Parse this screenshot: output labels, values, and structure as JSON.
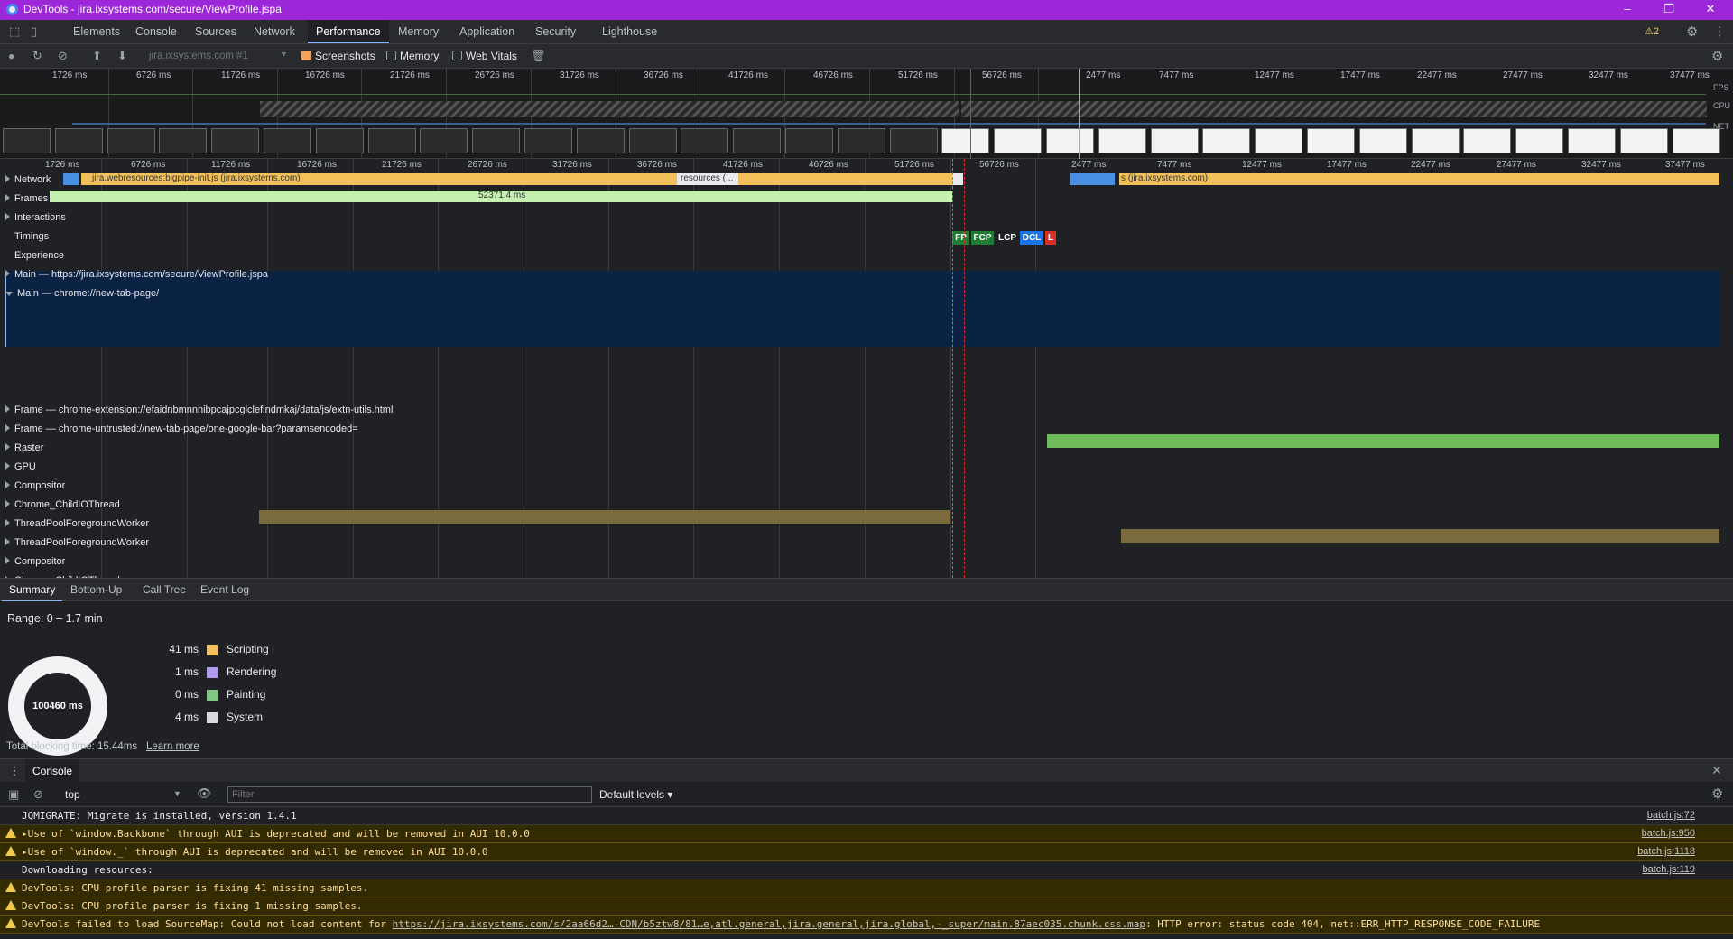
{
  "window": {
    "title": "DevTools - jira.ixsystems.com/secure/ViewProfile.jspa",
    "minimize": "–",
    "restore": "❐",
    "close": "✕"
  },
  "tabs": [
    "Elements",
    "Console",
    "Sources",
    "Network",
    "Performance",
    "Memory",
    "Application",
    "Security",
    "Lighthouse"
  ],
  "active_tab": "Performance",
  "warnings_badge": "⚠2",
  "toolbar": {
    "target_select": "jira.ixsystems.com #1",
    "screenshots_label": "Screenshots",
    "memory_label": "Memory",
    "webvitals_label": "Web Vitals"
  },
  "overview": {
    "ticks_left": [
      "1726 ms",
      "6726 ms",
      "11726 ms",
      "16726 ms",
      "21726 ms",
      "26726 ms",
      "31726 ms",
      "36726 ms",
      "41726 ms",
      "46726 ms",
      "51726 ms",
      "56726 ms"
    ],
    "ticks_right": [
      "2477 ms",
      "7477 ms",
      "12477 ms",
      "17477 ms",
      "22477 ms",
      "27477 ms",
      "32477 ms",
      "37477 ms"
    ],
    "labels": {
      "fps": "FPS",
      "cpu": "CPU",
      "net": "NET"
    }
  },
  "timeline": {
    "ticks_left": [
      "1726 ms",
      "6726 ms",
      "11726 ms",
      "16726 ms",
      "21726 ms",
      "26726 ms",
      "31726 ms",
      "36726 ms",
      "41726 ms",
      "46726 ms",
      "51726 ms",
      "56726 ms"
    ],
    "ticks_right": [
      "2477 ms",
      "7477 ms",
      "12477 ms",
      "17477 ms",
      "22477 ms",
      "27477 ms",
      "32477 ms",
      "37477 ms"
    ],
    "network_bar_label": "jira.webresources:bigpipe-init.js (jira.ixsystems.com)",
    "network_bar_label2": "resources (...",
    "network_bar_label3": "s (jira.ixsystems.com)",
    "frames_duration": "52371.4 ms",
    "markers": [
      "FP",
      "FCP",
      "LCP",
      "DCL",
      "L"
    ]
  },
  "tracks": [
    {
      "name": "Network",
      "expanded": false
    },
    {
      "name": "Frames",
      "expanded": false
    },
    {
      "name": "Interactions",
      "expanded": false
    },
    {
      "name": "Timings",
      "expanded": false
    },
    {
      "name": "Experience",
      "expanded": false
    },
    {
      "name": "Main — https://jira.ixsystems.com/secure/ViewProfile.jspa",
      "expanded": false
    },
    {
      "name": "Main — chrome://new-tab-page/",
      "expanded": true
    },
    {
      "name": "Frame — chrome-extension://efaidnbmnnnibpcajpcglclefindmkaj/data/js/extn-utils.html",
      "expanded": false
    },
    {
      "name": "Frame — chrome-untrusted://new-tab-page/one-google-bar?paramsencoded=",
      "expanded": false
    },
    {
      "name": "Raster",
      "expanded": false
    },
    {
      "name": "GPU",
      "expanded": false
    },
    {
      "name": "Compositor",
      "expanded": false
    },
    {
      "name": "Chrome_ChildIOThread",
      "expanded": false
    },
    {
      "name": "ThreadPoolForegroundWorker",
      "expanded": false
    },
    {
      "name": "ThreadPoolForegroundWorker",
      "expanded": false
    },
    {
      "name": "Compositor",
      "expanded": false
    },
    {
      "name": "Chrome_ChildIOThread",
      "expanded": false
    }
  ],
  "bottom_tabs": [
    "Summary",
    "Bottom-Up",
    "Call Tree",
    "Event Log"
  ],
  "summary": {
    "range": "Range: 0 – 1.7 min",
    "total": "100460 ms",
    "legend": [
      {
        "value": "41 ms",
        "label": "Scripting",
        "color": "#f2c15a"
      },
      {
        "value": "1 ms",
        "label": "Rendering",
        "color": "#b19cf0"
      },
      {
        "value": "0 ms",
        "label": "Painting",
        "color": "#81c784"
      },
      {
        "value": "4 ms",
        "label": "System",
        "color": "#dadce0"
      }
    ],
    "blocking_time": "Total blocking time: 15.44ms",
    "learn_more": "Learn more"
  },
  "console": {
    "title": "Console",
    "context": "top",
    "filter_placeholder": "Filter",
    "levels": "Default levels ▾",
    "lines": [
      {
        "type": "info",
        "text": "JQMIGRATE: Migrate is installed, version 1.4.1",
        "source": "batch.js:72"
      },
      {
        "type": "warn",
        "text": "▸Use of `window.Backbone` through AUI is deprecated and will be removed in AUI 10.0.0",
        "source": "batch.js:950"
      },
      {
        "type": "warn",
        "text": "▸Use of `window._` through AUI is deprecated and will be removed in AUI 10.0.0",
        "source": "batch.js:1118"
      },
      {
        "type": "info",
        "text": "Downloading resources:",
        "source": "batch.js:119"
      },
      {
        "type": "warn",
        "text": "DevTools: CPU profile parser is fixing 41 missing samples.",
        "source": ""
      },
      {
        "type": "warn",
        "text": "DevTools: CPU profile parser is fixing 1 missing samples.",
        "source": ""
      }
    ],
    "last_line": {
      "prefix": "DevTools failed to load SourceMap: Could not load content for ",
      "url": "https://jira.ixsystems.com/s/2aa66d2…-CDN/b5ztw8/81…e,atl.general,jira.general,jira.global,-_super/main.87aec035.chunk.css.map",
      "suffix": ": HTTP error: status code 404, net::ERR_HTTP_RESPONSE_CODE_FAILURE"
    }
  }
}
